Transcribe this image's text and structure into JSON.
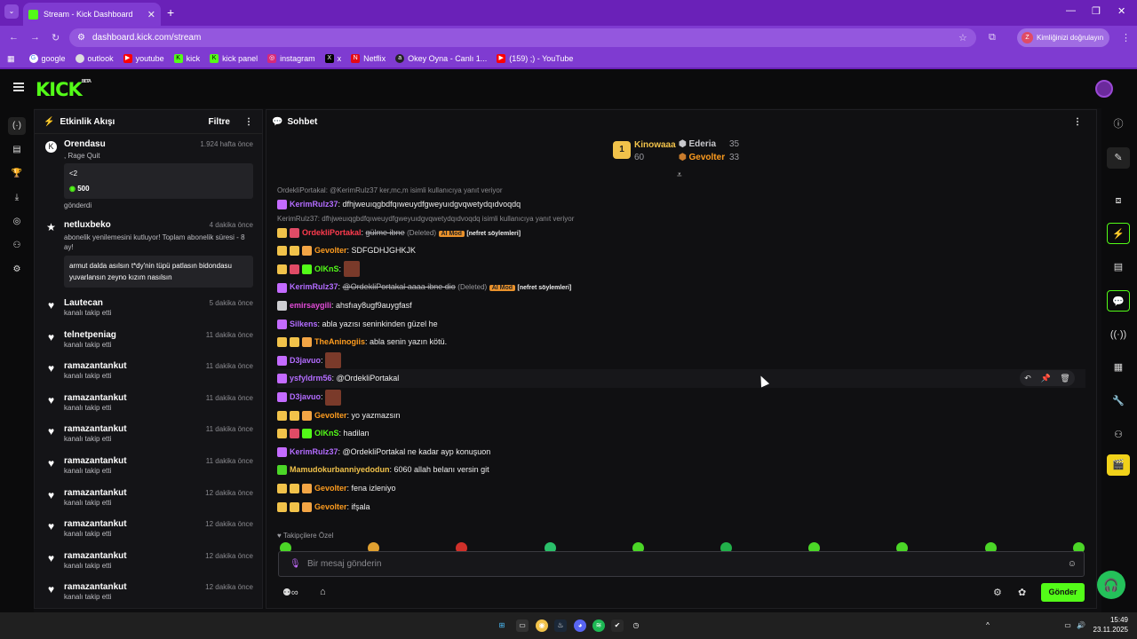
{
  "browser": {
    "tab_title": "Stream - Kick Dashboard",
    "url": "dashboard.kick.com/stream",
    "verify_label": "Kimliğinizi doğrulayın",
    "verify_avatar": "Z",
    "bookmarks": [
      "google",
      "outlook",
      "youtube",
      "kick",
      "kick panel",
      "instagram",
      "x",
      "Netflix",
      "Okey Oyna - Canlı 1...",
      "(159) ;) - YouTube"
    ]
  },
  "app": {
    "logo": "KICK",
    "logo_badge": "BETA"
  },
  "activity": {
    "title": "Etkinlik Akışı",
    "filter": "Filtre",
    "events": [
      {
        "name": "Orendasu",
        "time": "1.924 hafta önce",
        "sub": ", Rage Quit",
        "box": "<2",
        "amount": "500",
        "foot": "gönderdi"
      },
      {
        "name": "netluxbeko",
        "time": "4 dakika önce",
        "sub": "abonelik yenilemesini kutluyor! Toplam abonelik süresi - 8 ay!",
        "box": "armut dalda asılsın t*dy'nin tüpü patlasın bidondasu yuvarlansın zeyno kızım nasılsın"
      },
      {
        "name": "Lautecan",
        "time": "5 dakika önce",
        "sub": "kanalı takip etti"
      },
      {
        "name": "telnetpeniag",
        "time": "11 dakika önce",
        "sub": "kanalı takip etti"
      },
      {
        "name": "ramazantankut",
        "time": "11 dakika önce",
        "sub": "kanalı takip etti"
      },
      {
        "name": "ramazantankut",
        "time": "11 dakika önce",
        "sub": "kanalı takip etti"
      },
      {
        "name": "ramazantankut",
        "time": "11 dakika önce",
        "sub": "kanalı takip etti"
      },
      {
        "name": "ramazantankut",
        "time": "11 dakika önce",
        "sub": "kanalı takip etti"
      },
      {
        "name": "ramazantankut",
        "time": "12 dakika önce",
        "sub": "kanalı takip etti"
      },
      {
        "name": "ramazantankut",
        "time": "12 dakika önce",
        "sub": "kanalı takip etti"
      },
      {
        "name": "ramazantankut",
        "time": "12 dakika önce",
        "sub": "kanalı takip etti"
      },
      {
        "name": "ramazantankut",
        "time": "12 dakika önce",
        "sub": "kanalı takip etti"
      }
    ]
  },
  "chat": {
    "title": "Sohbet",
    "leaderboard": {
      "first": {
        "rank": "1",
        "name": "Kinowaaa",
        "value": "60"
      },
      "second": {
        "name": "Ederia",
        "value": "35"
      },
      "third": {
        "name": "Gevolter",
        "value": "33"
      }
    },
    "messages": [
      {
        "reply": "OrdekliPortakal: @KerimRulz37 ker,mc,m isimli kullanıcıya yanıt veriyor",
        "user": "KerimRulz37",
        "color": "#b36cff",
        "text": "dfhjweuıqgbdfqıweuydfgweyuıdgvqwetydqıdvoqdq"
      },
      {
        "reply": "KerimRulz37: dfhjweuıqgbdfqıweuydfgweyuıdgvqwetydqıdvoqdq isimli kullanıcıya yanıt veriyor",
        "user": "OrdekliPortakal",
        "color": "#ff3b4e",
        "text": "gülme ibne",
        "deleted": "(Deleted)",
        "aimod": "AI Mod",
        "flag": "[nefret söylemleri]"
      },
      {
        "user": "Gevolter",
        "color": "#ff9d1f",
        "text": "SDFGDHJGHKJK"
      },
      {
        "user": "OlKnS",
        "color": "#53fc18",
        "text": ""
      },
      {
        "user": "KerimRulz37",
        "color": "#b36cff",
        "text": "@OrdekliPortakal aaaa ibne dio",
        "deleted": "(Deleted)",
        "aimod": "AI Mod",
        "flag": "[nefret söylemleri]"
      },
      {
        "user": "emirsaygili",
        "color": "#e24bd8",
        "text": "ahsfıay8ugf9auygfasf"
      },
      {
        "user": "Silkens",
        "color": "#b36cff",
        "text": "abla yazısı seninkinden güzel he"
      },
      {
        "user": "TheAninogiis",
        "color": "#ff9d1f",
        "text": "abla senin yazın kötü."
      },
      {
        "user": "D3javuo",
        "color": "#b36cff",
        "text": ""
      },
      {
        "user": "ysfyldrm56",
        "color": "#b36cff",
        "text": "@OrdekliPortakal"
      },
      {
        "user": "D3javuo",
        "color": "#b36cff",
        "text": ""
      },
      {
        "user": "Gevolter",
        "color": "#ff9d1f",
        "text": "yo yazmazsın"
      },
      {
        "user": "OlKnS",
        "color": "#53fc18",
        "text": "hadilan"
      },
      {
        "user": "KerimRulz37",
        "color": "#b36cff",
        "text": "@OrdekliPortakal ne kadar ayp konuşuon"
      },
      {
        "user": "Mamudokurbanniyedodun",
        "color": "#f1c24a",
        "text": "6060 allah belanı versin git"
      },
      {
        "user": "Gevolter",
        "color": "#ff9d1f",
        "text": "fena izleniyo"
      },
      {
        "user": "Gevolter",
        "color": "#ff9d1f",
        "text": "ifşala"
      }
    ],
    "emote_label": "Takipçilere Özel",
    "input_placeholder": "Bir mesaj gönderin",
    "send_label": "Gönder"
  },
  "taskbar": {
    "time": "15:49",
    "date": "23.11.2025"
  }
}
